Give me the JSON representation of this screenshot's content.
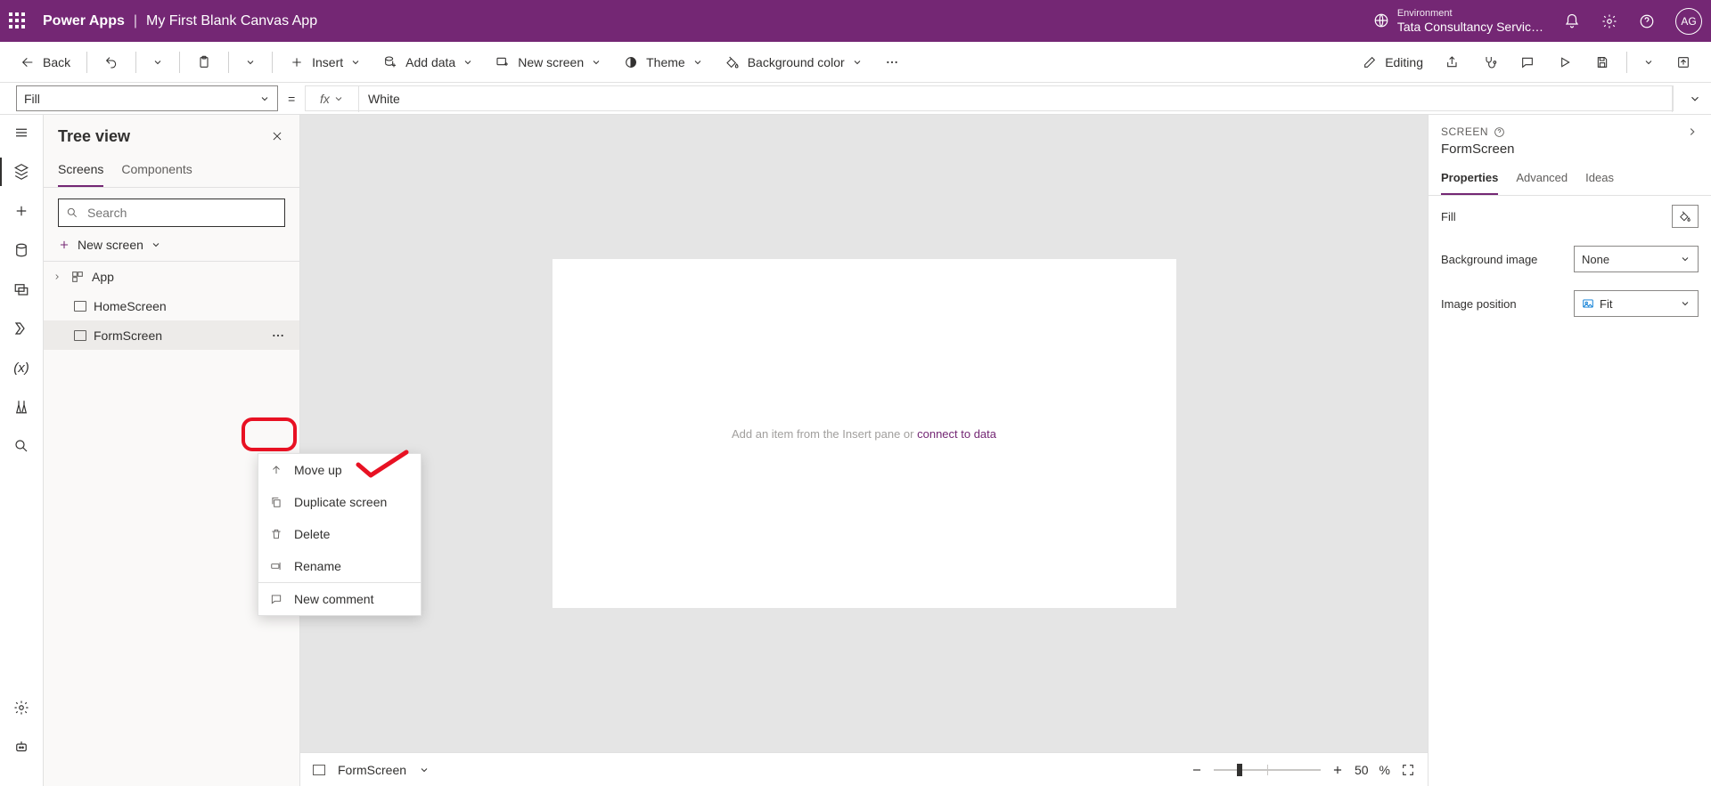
{
  "header": {
    "product": "Power Apps",
    "separator": "|",
    "app_name": "My First Blank Canvas App",
    "env_label": "Environment",
    "env_name": "Tata Consultancy Servic…",
    "avatar": "AG"
  },
  "cmdbar": {
    "back": "Back",
    "insert": "Insert",
    "add_data": "Add data",
    "new_screen": "New screen",
    "theme": "Theme",
    "bg_color": "Background color",
    "editing": "Editing"
  },
  "formula": {
    "property": "Fill",
    "fx": "fx",
    "value": "White"
  },
  "tree": {
    "title": "Tree view",
    "tabs": {
      "screens": "Screens",
      "components": "Components"
    },
    "search_placeholder": "Search",
    "new_screen": "New screen",
    "items": {
      "app": "App",
      "home": "HomeScreen",
      "form": "FormScreen"
    }
  },
  "ctx": {
    "move_up": "Move up",
    "duplicate": "Duplicate screen",
    "delete": "Delete",
    "rename": "Rename",
    "new_comment": "New comment"
  },
  "canvas": {
    "hint_pre": "Add an item from the Insert pane",
    "hint_or": " or ",
    "hint_link": "connect to data",
    "footer_screen": "FormScreen",
    "zoom_value": "50",
    "zoom_pct": "%"
  },
  "props": {
    "category": "SCREEN",
    "name": "FormScreen",
    "tabs": {
      "properties": "Properties",
      "advanced": "Advanced",
      "ideas": "Ideas"
    },
    "rows": {
      "fill": "Fill",
      "bg_image": "Background image",
      "bg_image_val": "None",
      "img_pos": "Image position",
      "img_pos_val": "Fit"
    }
  }
}
